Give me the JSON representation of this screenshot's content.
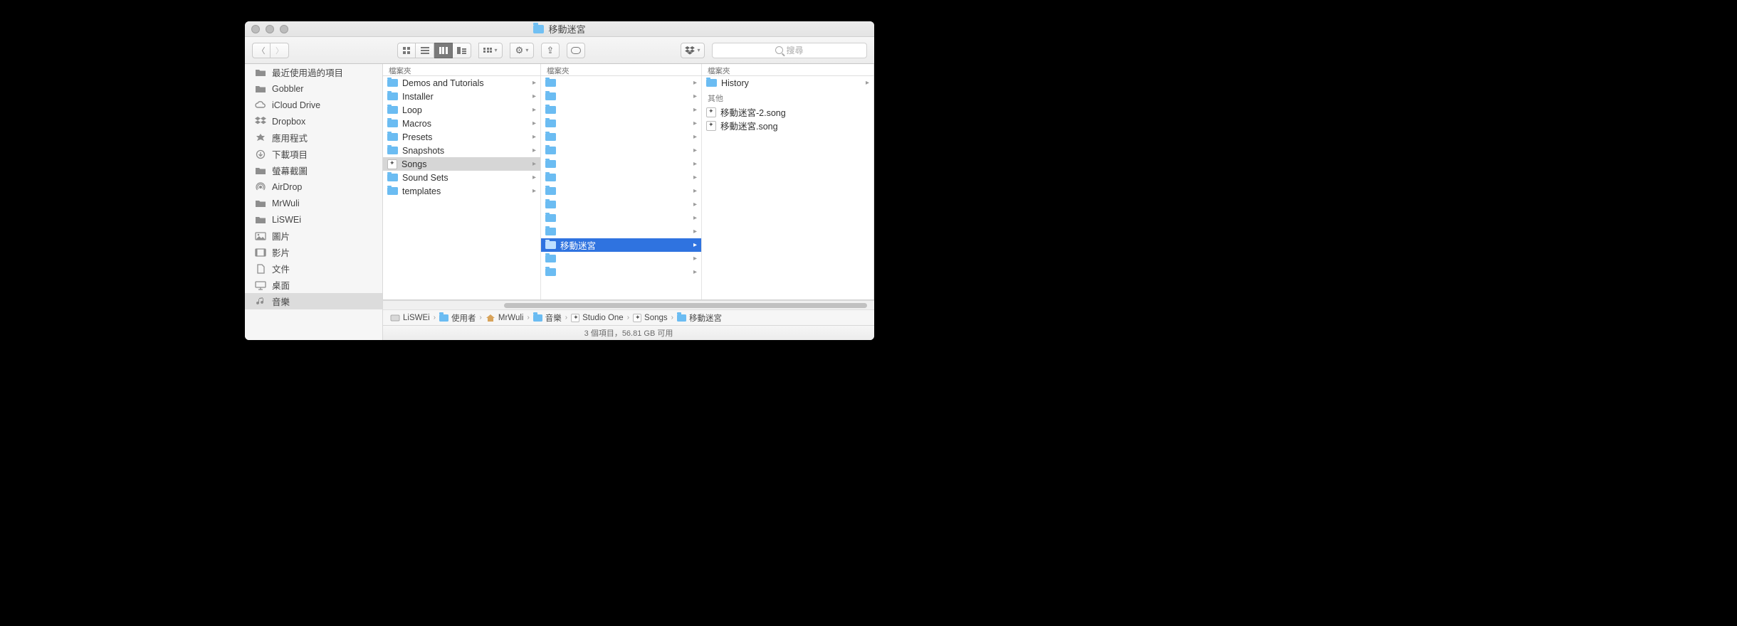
{
  "window": {
    "title": "移動迷宮"
  },
  "toolbar": {
    "search_placeholder": "搜尋",
    "view_modes": [
      "icon",
      "list",
      "column",
      "gallery"
    ],
    "active_view": "column"
  },
  "sidebar": {
    "items": [
      {
        "label": "最近使用過的項目",
        "icon": "folder"
      },
      {
        "label": "Gobbler",
        "icon": "folder"
      },
      {
        "label": "iCloud Drive",
        "icon": "cloud"
      },
      {
        "label": "Dropbox",
        "icon": "dropbox"
      },
      {
        "label": "應用程式",
        "icon": "apps"
      },
      {
        "label": "下載項目",
        "icon": "download"
      },
      {
        "label": "螢幕截圖",
        "icon": "folder"
      },
      {
        "label": "AirDrop",
        "icon": "airdrop"
      },
      {
        "label": "MrWuli",
        "icon": "folder"
      },
      {
        "label": "LiSWEi",
        "icon": "folder"
      },
      {
        "label": "圖片",
        "icon": "photo"
      },
      {
        "label": "影片",
        "icon": "video"
      },
      {
        "label": "文件",
        "icon": "doc"
      },
      {
        "label": "桌面",
        "icon": "desktop"
      },
      {
        "label": "音樂",
        "icon": "music",
        "selected": true
      }
    ]
  },
  "columns": {
    "header": "檔案夾",
    "col1": [
      {
        "label": "Demos and Tutorials",
        "type": "folder",
        "chev": true
      },
      {
        "label": "Installer",
        "type": "folder",
        "chev": true
      },
      {
        "label": "Loop",
        "type": "folder",
        "chev": true
      },
      {
        "label": "Macros",
        "type": "folder",
        "chev": true
      },
      {
        "label": "Presets",
        "type": "folder",
        "chev": true
      },
      {
        "label": "Snapshots",
        "type": "folder",
        "chev": true
      },
      {
        "label": "Songs",
        "type": "app",
        "chev": true,
        "selected": true
      },
      {
        "label": "Sound Sets",
        "type": "folder",
        "chev": true
      },
      {
        "label": "templates",
        "type": "folder",
        "chev": true
      }
    ],
    "col2_blank_above": 12,
    "col2_selected": {
      "label": "移動迷宮"
    },
    "col2_blank_below": 2,
    "col3": {
      "folders": [
        {
          "label": "History",
          "chev": true
        }
      ],
      "other_header": "其他",
      "files": [
        {
          "label": "移動迷宮-2.song"
        },
        {
          "label": "移動迷宮.song"
        }
      ]
    }
  },
  "path": [
    {
      "label": "LiSWEi",
      "icon": "disk"
    },
    {
      "label": "使用者",
      "icon": "folder"
    },
    {
      "label": "MrWuli",
      "icon": "home"
    },
    {
      "label": "音樂",
      "icon": "folder"
    },
    {
      "label": "Studio One",
      "icon": "app"
    },
    {
      "label": "Songs",
      "icon": "app"
    },
    {
      "label": "移動迷宮",
      "icon": "folder"
    }
  ],
  "status": "3 個項目，56.81 GB 可用"
}
